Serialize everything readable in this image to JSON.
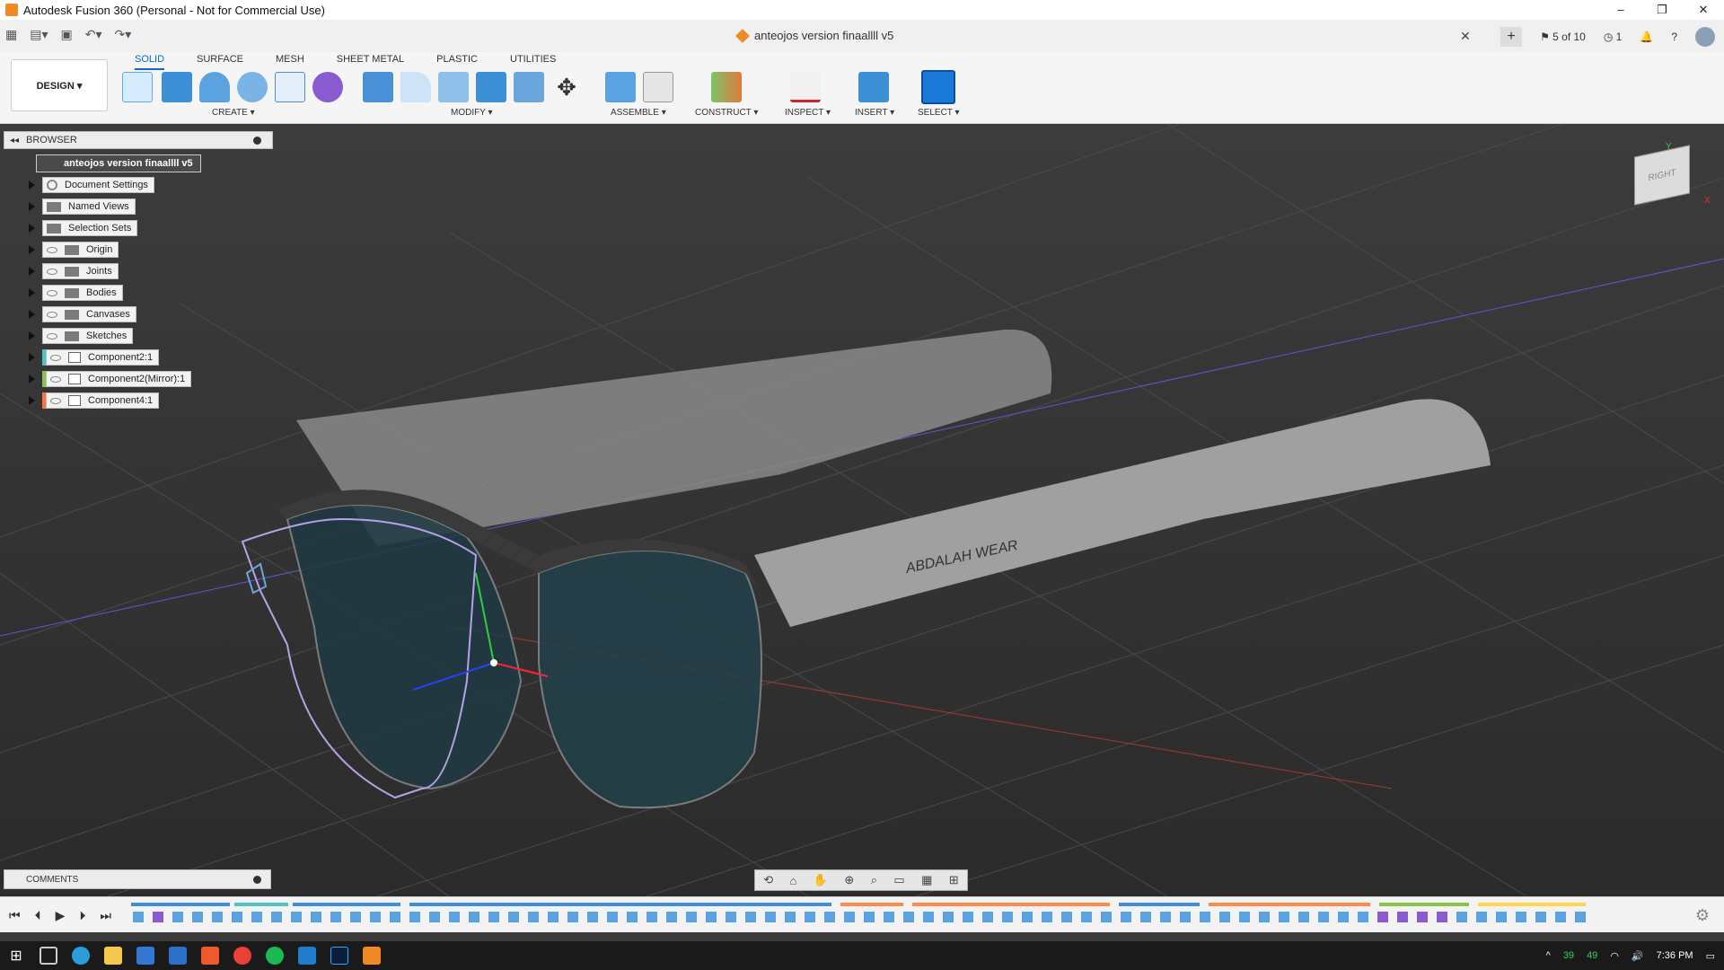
{
  "window": {
    "title": "Autodesk Fusion 360 (Personal - Not for Commercial Use)",
    "controls": [
      "–",
      "❐",
      "✕"
    ]
  },
  "document_tab": {
    "name": "anteojos version finaallll v5",
    "close": "✕"
  },
  "tab_right": {
    "job_status": "5 of 10",
    "notifications": "1",
    "help": "?"
  },
  "design_button": "DESIGN ▾",
  "ribbon_tabs": [
    "SOLID",
    "SURFACE",
    "MESH",
    "SHEET METAL",
    "PLASTIC",
    "UTILITIES"
  ],
  "ribbon_groups": [
    "CREATE ▾",
    "MODIFY ▾",
    "ASSEMBLE ▾",
    "CONSTRUCT ▾",
    "INSPECT ▾",
    "INSERT ▾",
    "SELECT ▾"
  ],
  "browser": {
    "header": "BROWSER",
    "root": "anteojos version finaallll v5",
    "items": [
      "Document Settings",
      "Named Views",
      "Selection Sets",
      "Origin",
      "Joints",
      "Bodies",
      "Canvases",
      "Sketches",
      "Component2:1",
      "Component2(Mirror):1",
      "Component4:1"
    ]
  },
  "model": {
    "temple_text": "ABDALAH WEAR"
  },
  "viewcube": {
    "face_label": "RIGHT",
    "axis_x": "X",
    "axis_y": "Y"
  },
  "comments": {
    "header": "COMMENTS"
  },
  "taskbar": {
    "temp_1": "39",
    "temp_2": "49",
    "time": "7:36 PM"
  },
  "colors": {
    "accent": "#0a6ac8",
    "brand_orange": "#f08a24",
    "viewport_bg": "#333333",
    "component_green": "#8bc34a",
    "component_orange": "#ff7043"
  }
}
